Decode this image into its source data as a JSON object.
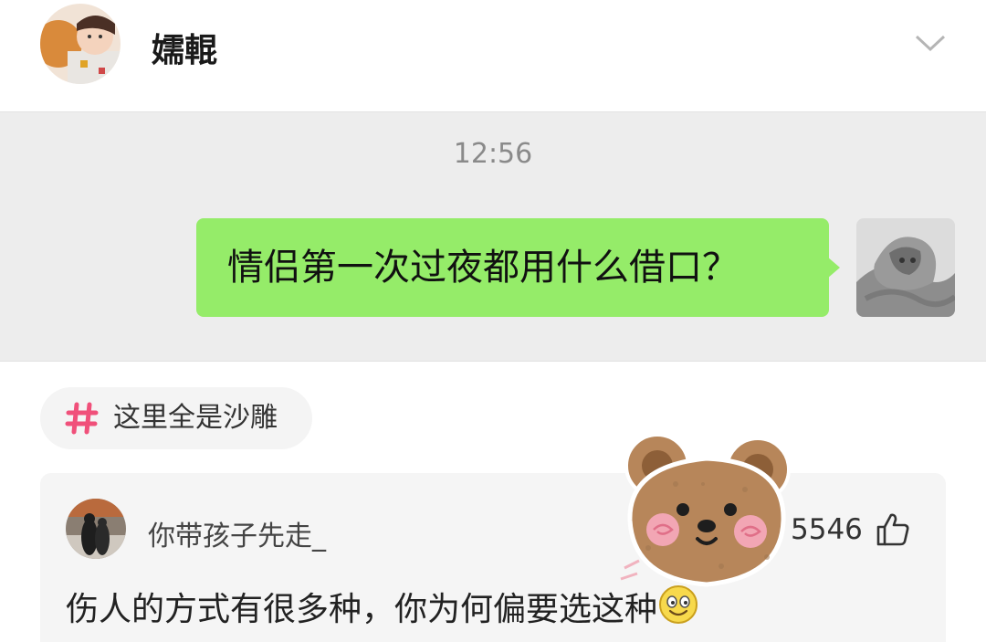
{
  "header": {
    "username": "嬬輥",
    "avatar_icon": "child-photo-avatar",
    "expand_icon": "chevron-down-icon"
  },
  "chat": {
    "time": "12:56",
    "message": "情侣第一次过夜都用什么借口？",
    "bubble_color": "#95ec69",
    "sender_avatar_icon": "cat-in-blanket-avatar"
  },
  "topic": {
    "icon": "hash-icon",
    "label": "这里全是沙雕",
    "accent": "#f0507a"
  },
  "comment": {
    "username": "你带孩子先走_",
    "likes": "5546",
    "like_icon": "thumbs-up-icon",
    "text": "伤人的方式有很多种，你为何偏要选这种",
    "emoji": "smile-emoji"
  },
  "sticker": {
    "icon": "bear-sticker"
  }
}
